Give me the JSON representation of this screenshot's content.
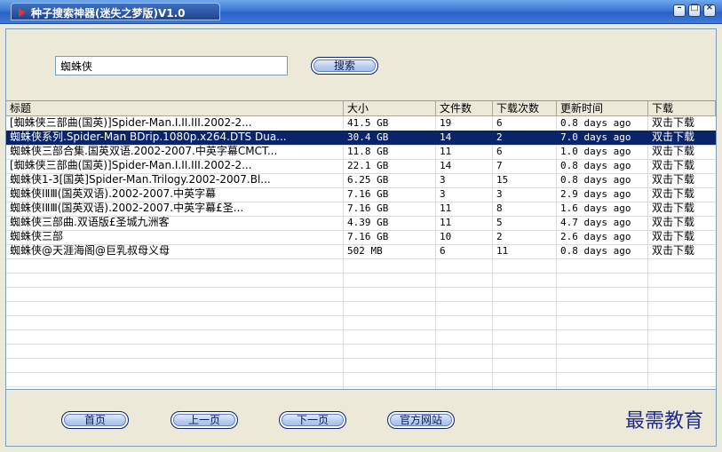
{
  "window": {
    "title": "种子搜索神器(迷失之梦版)V1.0"
  },
  "search": {
    "value": "蜘蛛侠",
    "button_label": "搜索"
  },
  "table": {
    "columns": [
      "标题",
      "大小",
      "文件数",
      "下载次数",
      "更新时间",
      "下载"
    ],
    "rows": [
      {
        "title": "[蜘蛛侠三部曲(国英)]Spider-Man.I.II.III.2002-2...",
        "size": "41.5 GB",
        "files": "19",
        "downloads": "6",
        "updated": "0.8 days ago",
        "action": "双击下载"
      },
      {
        "title": "蜘蛛侠系列.Spider-Man BDrip.1080p.x264.DTS Dua...",
        "size": "30.4 GB",
        "files": "14",
        "downloads": "2",
        "updated": "7.0 days ago",
        "action": "双击下载",
        "selected": true
      },
      {
        "title": "蜘蛛侠三部合集.国英双语.2002-2007.中英字幕CMCT...",
        "size": "11.8 GB",
        "files": "11",
        "downloads": "6",
        "updated": "1.0 days ago",
        "action": "双击下载"
      },
      {
        "title": "[蜘蛛侠三部曲(国英)]Spider-Man.I.II.III.2002-2...",
        "size": "22.1 GB",
        "files": "14",
        "downloads": "7",
        "updated": "0.8 days ago",
        "action": "双击下载"
      },
      {
        "title": "蜘蛛侠1-3[国英]Spider-Man.Trilogy.2002-2007.Bl...",
        "size": "6.25 GB",
        "files": "3",
        "downloads": "15",
        "updated": "0.8 days ago",
        "action": "双击下载"
      },
      {
        "title": "蜘蛛侠ⅠⅡⅢ(国英双语).2002-2007.中英字幕",
        "size": "7.16 GB",
        "files": "3",
        "downloads": "3",
        "updated": "2.9 days ago",
        "action": "双击下载"
      },
      {
        "title": "蜘蛛侠ⅠⅡⅢ(国英双语).2002-2007.中英字幕£圣...",
        "size": "7.16 GB",
        "files": "11",
        "downloads": "8",
        "updated": "1.6 days ago",
        "action": "双击下载"
      },
      {
        "title": "蜘蛛侠三部曲.双语版£圣城九洲客",
        "size": "4.39 GB",
        "files": "11",
        "downloads": "5",
        "updated": "4.7 days ago",
        "action": "双击下载"
      },
      {
        "title": "蜘蛛侠三部",
        "size": "7.16 GB",
        "files": "10",
        "downloads": "2",
        "updated": "2.6 days ago",
        "action": "双击下载"
      },
      {
        "title": "蜘蛛侠@天涯海阁@巨乳叔母义母",
        "size": "502 MB",
        "files": "6",
        "downloads": "11",
        "updated": "0.8 days ago",
        "action": "双击下载"
      }
    ]
  },
  "footer": {
    "first_label": "首页",
    "prev_label": "上一页",
    "next_label": "下一页",
    "site_label": "官方网站",
    "brand_text": "最需教育"
  },
  "icons": {
    "app": "play-icon",
    "minimize": "minimize-icon",
    "maximize": "maximize-icon",
    "close": "close-icon"
  },
  "colors": {
    "titlebar": "#3b78d6",
    "selection": "#0a246a",
    "brand": "#1c2b8c"
  }
}
